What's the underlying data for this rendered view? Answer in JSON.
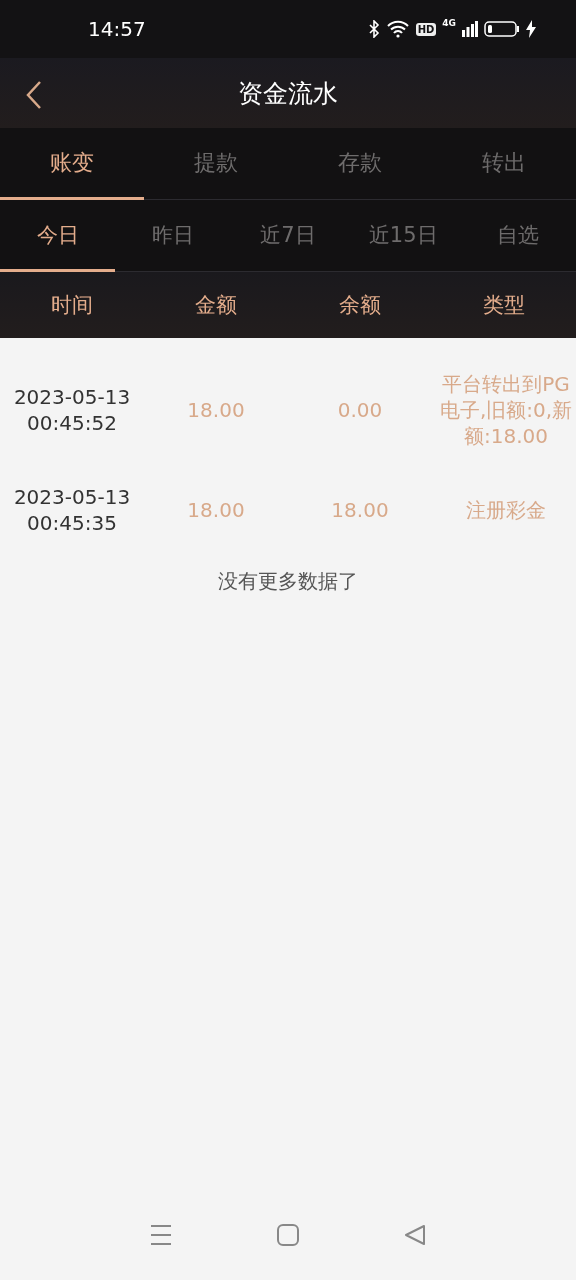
{
  "status_bar": {
    "time": "14:57",
    "hd": "HD",
    "network": "4G"
  },
  "header": {
    "title": "资金流水"
  },
  "tabs": [
    {
      "label": "账变",
      "selected": true
    },
    {
      "label": "提款",
      "selected": false
    },
    {
      "label": "存款",
      "selected": false
    },
    {
      "label": "转出",
      "selected": false
    }
  ],
  "period_tabs": [
    {
      "label": "今日",
      "selected": true
    },
    {
      "label": "昨日",
      "selected": false
    },
    {
      "label": "近7日",
      "selected": false
    },
    {
      "label": "近15日",
      "selected": false
    },
    {
      "label": "自选",
      "selected": false
    }
  ],
  "table": {
    "columns": [
      "时间",
      "金额",
      "余额",
      "类型"
    ],
    "rows": [
      {
        "time": "2023-05-13 00:45:52",
        "amount": "18.00",
        "balance": "0.00",
        "type": "平台转出到PG电子,旧额:0,新额:18.00"
      },
      {
        "time": "2023-05-13 00:45:35",
        "amount": "18.00",
        "balance": "18.00",
        "type": "注册彩金"
      }
    ],
    "footer": "没有更多数据了"
  }
}
